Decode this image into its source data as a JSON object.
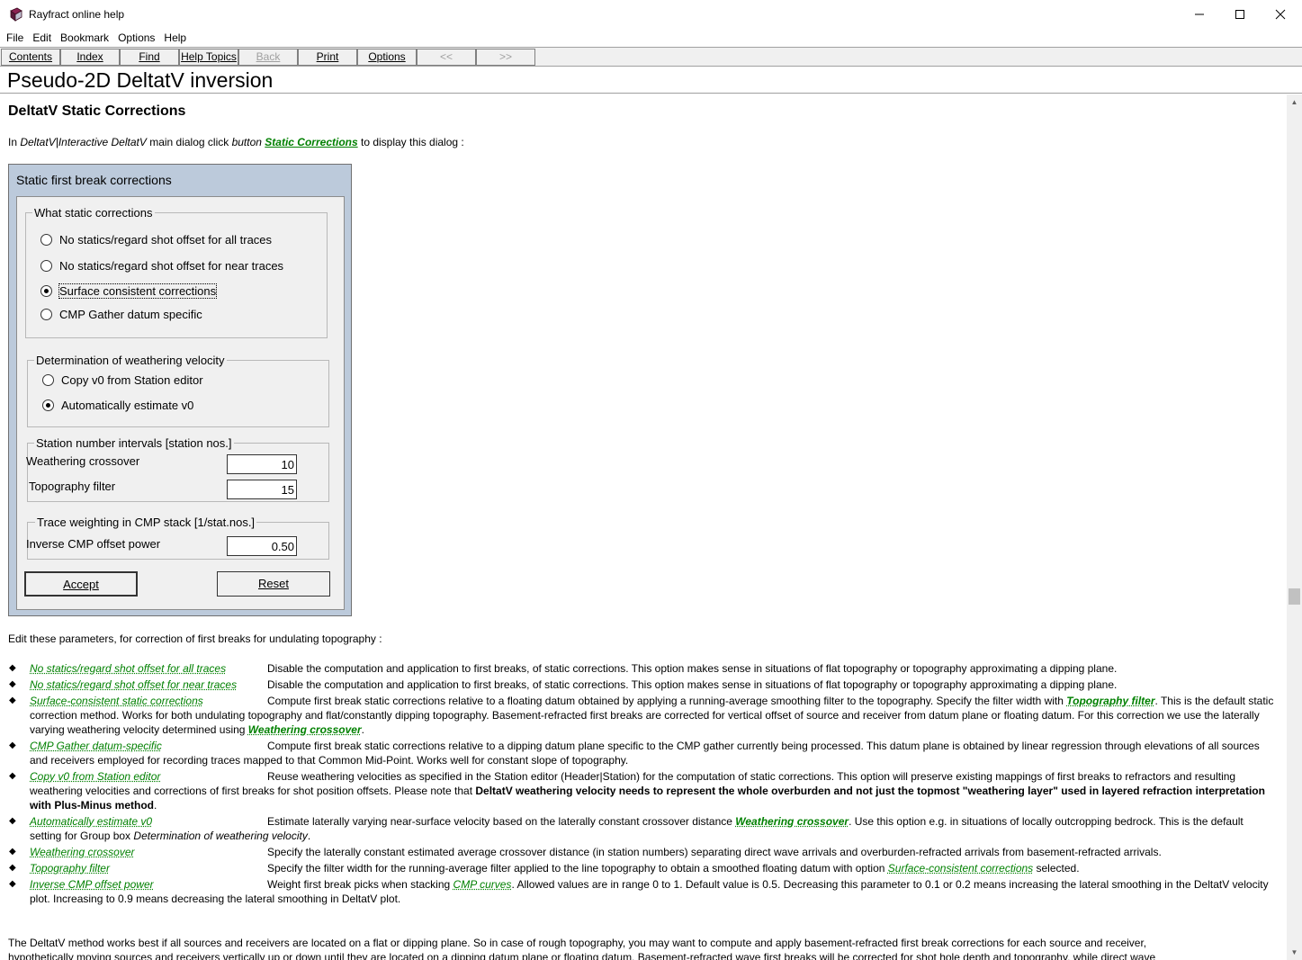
{
  "window": {
    "title": "Rayfract online help",
    "minimize": "—",
    "maximize": "☐",
    "close": "✕"
  },
  "menu": [
    "File",
    "Edit",
    "Bookmark",
    "Options",
    "Help"
  ],
  "toolbar": [
    {
      "label": "Contents",
      "enabled": true
    },
    {
      "label": "Index",
      "enabled": true
    },
    {
      "label": "Find",
      "enabled": true
    },
    {
      "label": "Help Topics",
      "enabled": true
    },
    {
      "label": "Back",
      "enabled": false
    },
    {
      "label": "Print",
      "enabled": true
    },
    {
      "label": "Options",
      "enabled": true
    },
    {
      "label": "<<",
      "enabled": false
    },
    {
      "label": ">>",
      "enabled": false
    }
  ],
  "topic_title": "Pseudo-2D DeltatV inversion",
  "section_heading": "DeltatV Static Corrections",
  "intro": {
    "prefix": "In ",
    "menu_path": "DeltatV|Interactive DeltatV",
    "middle": " main dialog click ",
    "button_word": "button",
    "link": "Static Corrections",
    "suffix": " to display this dialog :"
  },
  "dialog": {
    "title": "Static first break corrections",
    "group_static": {
      "label": "What static corrections",
      "options": [
        {
          "label": "No statics/regard shot offset for all traces",
          "selected": false
        },
        {
          "label": "No statics/regard shot offset for near traces",
          "selected": false
        },
        {
          "label": "Surface consistent corrections",
          "selected": true
        },
        {
          "label": "CMP Gather datum specific",
          "selected": false
        }
      ]
    },
    "group_weathering": {
      "label": "Determination of weathering velocity",
      "options": [
        {
          "label": "Copy v0 from Station editor",
          "selected": false
        },
        {
          "label": "Automatically estimate v0",
          "selected": true
        }
      ]
    },
    "group_intervals": {
      "label": "Station number intervals [station nos.]",
      "weathering_label": "Weathering crossover",
      "weathering_value": "10",
      "topography_label": "Topography filter",
      "topography_value": "15"
    },
    "group_weighting": {
      "label": "Trace weighting in CMP stack [1/stat.nos.]",
      "power_label": "Inverse CMP offset power",
      "power_value": "0.50"
    },
    "accept": "Accept",
    "reset": "Reset"
  },
  "edit_para": "Edit these parameters, for correction of first breaks for undulating topography :",
  "bullets": {
    "b1_term": "No statics/regard shot offset for all traces",
    "b1_desc": "Disable the computation and application to first breaks, of static corrections. This option makes sense in situations of flat topography or topography approximating a dipping plane.",
    "b2_term": "No statics/regard shot offset for near traces",
    "b2_desc": "Disable the computation and application to first breaks, of static corrections. This option makes sense in situations of flat topography or topography approximating a dipping plane.",
    "b3_term": "Surface-consistent static corrections",
    "b3_desc1": "Compute first break static corrections relative to a floating datum obtained by applying a running-average smoothing filter to the topography. Specify the filter width with ",
    "b3_link1": "Topography filter",
    "b3_desc2": ". This is the default static correction method. Works for both undulating topography and flat/constantly dipping topography. Basement-refracted first breaks are corrected for vertical offset of source and receiver from datum plane or floating datum. For this correction we use the laterally varying weathering velocity determined using ",
    "b3_link2": "Weathering crossover",
    "b3_desc3": ".",
    "b4_term": "CMP Gather datum-specific",
    "b4_desc": "Compute first break static corrections relative to a dipping datum plane specific to the CMP gather currently being processed. This datum plane is obtained by linear regression through elevations of all sources and receivers employed for recording traces mapped to that Common Mid-Point. Works well for constant slope of topography.",
    "b5_term": "Copy v0 from Station editor",
    "b5_desc1": "Reuse weathering velocities as specified in the Station editor (Header|Station) for the computation of static corrections. This option will preserve existing mappings of first breaks to refractors and resulting weathering velocities and corrections of first breaks for shot position offsets. Please note that ",
    "b5_bold": "DeltatV weathering velocity needs to represent the whole overburden and not just the topmost \"weathering layer\" used in layered refraction interpretation with Plus-Minus method",
    "b5_desc2": ".",
    "b6_term": "Automatically estimate v0",
    "b6_desc1": "Estimate laterally varying near-surface velocity based on the laterally constant crossover distance ",
    "b6_link": "Weathering crossover",
    "b6_desc2": ". Use this option e.g. in situations of locally outcropping bedrock. This is the default setting for Group box ",
    "b6_ital": "Determination of weathering velocity",
    "b6_desc3": ".",
    "b7_term": "Weathering crossover",
    "b7_desc": "Specify the laterally constant estimated average crossover distance (in station numbers) separating direct wave arrivals and overburden-refracted arrivals from basement-refracted arrivals.",
    "b8_term": "Topography filter",
    "b8_desc1": "Specify the filter width for the running-average filter applied to the line topography to obtain a smoothed floating datum with option ",
    "b8_link": "Surface-consistent corrections",
    "b8_desc2": " selected.",
    "b9_term": "Inverse CMP offset power",
    "b9_desc1": "Weight first break picks when stacking ",
    "b9_link": "CMP curves",
    "b9_desc2": ". Allowed values are in range 0 to 1. Default value is 0.5. Decreasing this parameter to 0.1 or 0.2 means increasing the lateral smoothing in the DeltatV velocity plot. Increasing to 0.9 means decreasing the lateral smoothing in DeltatV plot."
  },
  "final_para_line1": "The DeltatV method works best if all sources and receivers are located on a flat or dipping plane. So in case of rough topography, you may want to compute and apply basement-refracted first break corrections for each source and receiver,",
  "final_para_line2": "hypothetically moving sources and receivers vertically up or down until they are located on a dipping datum plane or floating datum. Basement-refracted wave first breaks will be corrected for shot hole depth and topography, while direct wave"
}
